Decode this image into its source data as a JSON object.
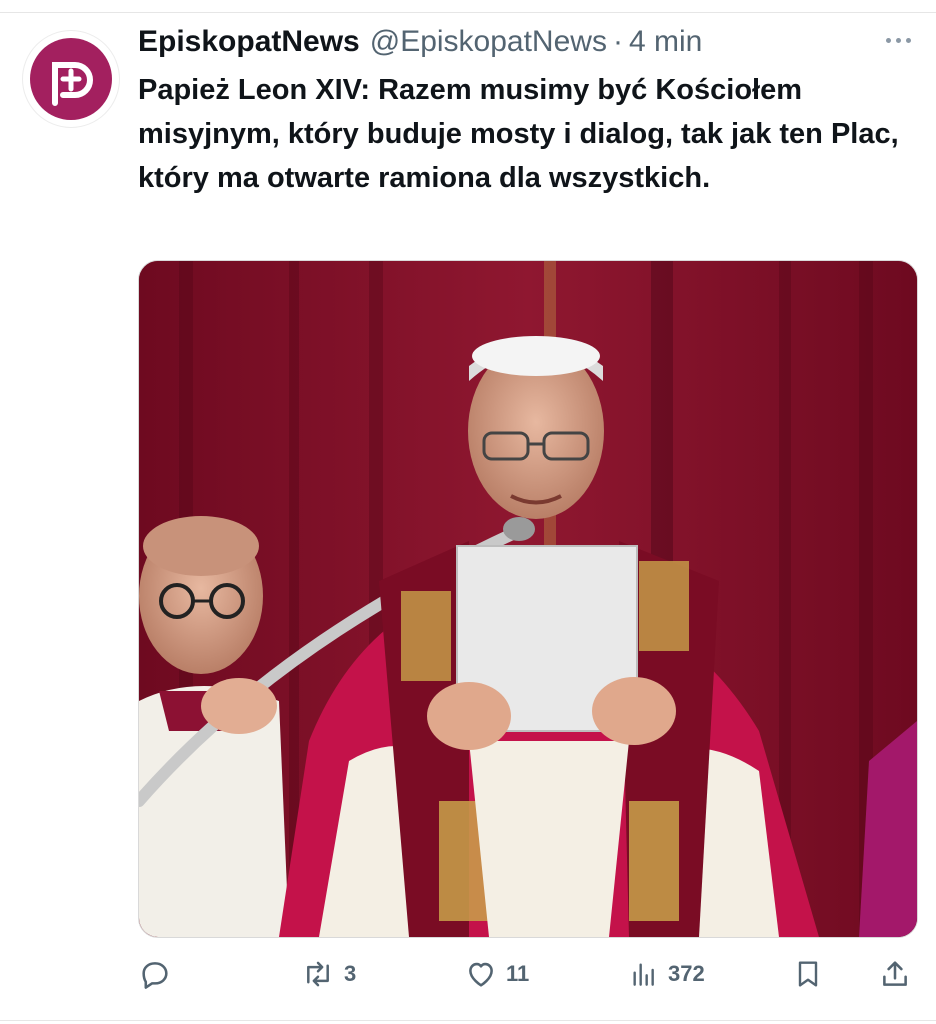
{
  "tweet": {
    "display_name": "EpiskopatNews",
    "handle": "@EpiskopatNews",
    "separator": "·",
    "time": "4 min",
    "text": "Papież Leon XIV: Razem musimy być Kościołem misyjnym, który buduje mosty i dialog, tak jak ten Plac, który ma otwarte ramiona dla wszystkich."
  },
  "actions": {
    "reply_count": "",
    "retweet_count": "3",
    "like_count": "11",
    "views_count": "372"
  },
  "colors": {
    "brand": "#a3205f",
    "text_primary": "#0f1419",
    "text_secondary": "#536471"
  },
  "icons": {
    "avatar": "cross-in-p-logo-icon",
    "more": "more-options-icon",
    "reply": "reply-icon",
    "retweet": "retweet-icon",
    "like": "heart-icon",
    "views": "views-chart-icon",
    "bookmark": "bookmark-icon",
    "share": "share-icon"
  }
}
